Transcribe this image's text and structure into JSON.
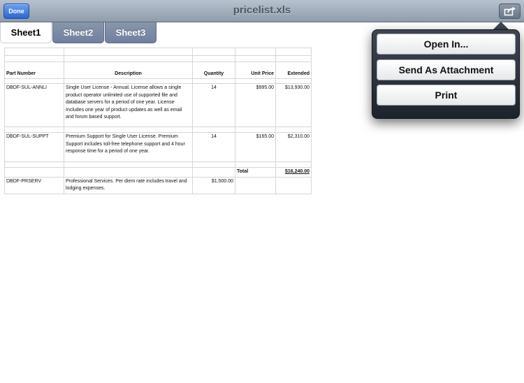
{
  "navbar": {
    "done_label": "Done",
    "title": "pricelist.xls",
    "action_icon": "share-icon"
  },
  "tabs": [
    {
      "label": "Sheet1",
      "active": true
    },
    {
      "label": "Sheet2",
      "active": false
    },
    {
      "label": "Sheet3",
      "active": false
    }
  ],
  "spreadsheet": {
    "headers": [
      "Part Number",
      "Description",
      "Quantity",
      "Unit Price",
      "Extended"
    ],
    "rows": [
      {
        "part": "DBDF-SUL-ANNLI",
        "description": "Single User License - Annual.  License allows a single product operator unlimited use of supported file and database servers for a period of one year.  License Includes one year of product updates as well as email and forum based support.",
        "quantity": "14",
        "unit_price": "$995.00",
        "extended": "$13,930.00"
      },
      {
        "part": "DBDF-SUL-SUPPT",
        "description": "Premium Support for Single User License.  Premium Support includes toll-free telephone support and 4 hour response time for a period of one year.",
        "quantity": "14",
        "unit_price": "$165.00",
        "extended": "$2,310.00"
      }
    ],
    "total_label": "Total",
    "total_value": "$16,240.00",
    "services_row": {
      "part": "DBDF-PRSERV",
      "description": "Professional Services.  Per diem rate includes travel and lodging expenses.",
      "quantity": "$1,500.00"
    }
  },
  "popover": {
    "items": [
      "Open In...",
      "Send As Attachment",
      "Print"
    ]
  }
}
